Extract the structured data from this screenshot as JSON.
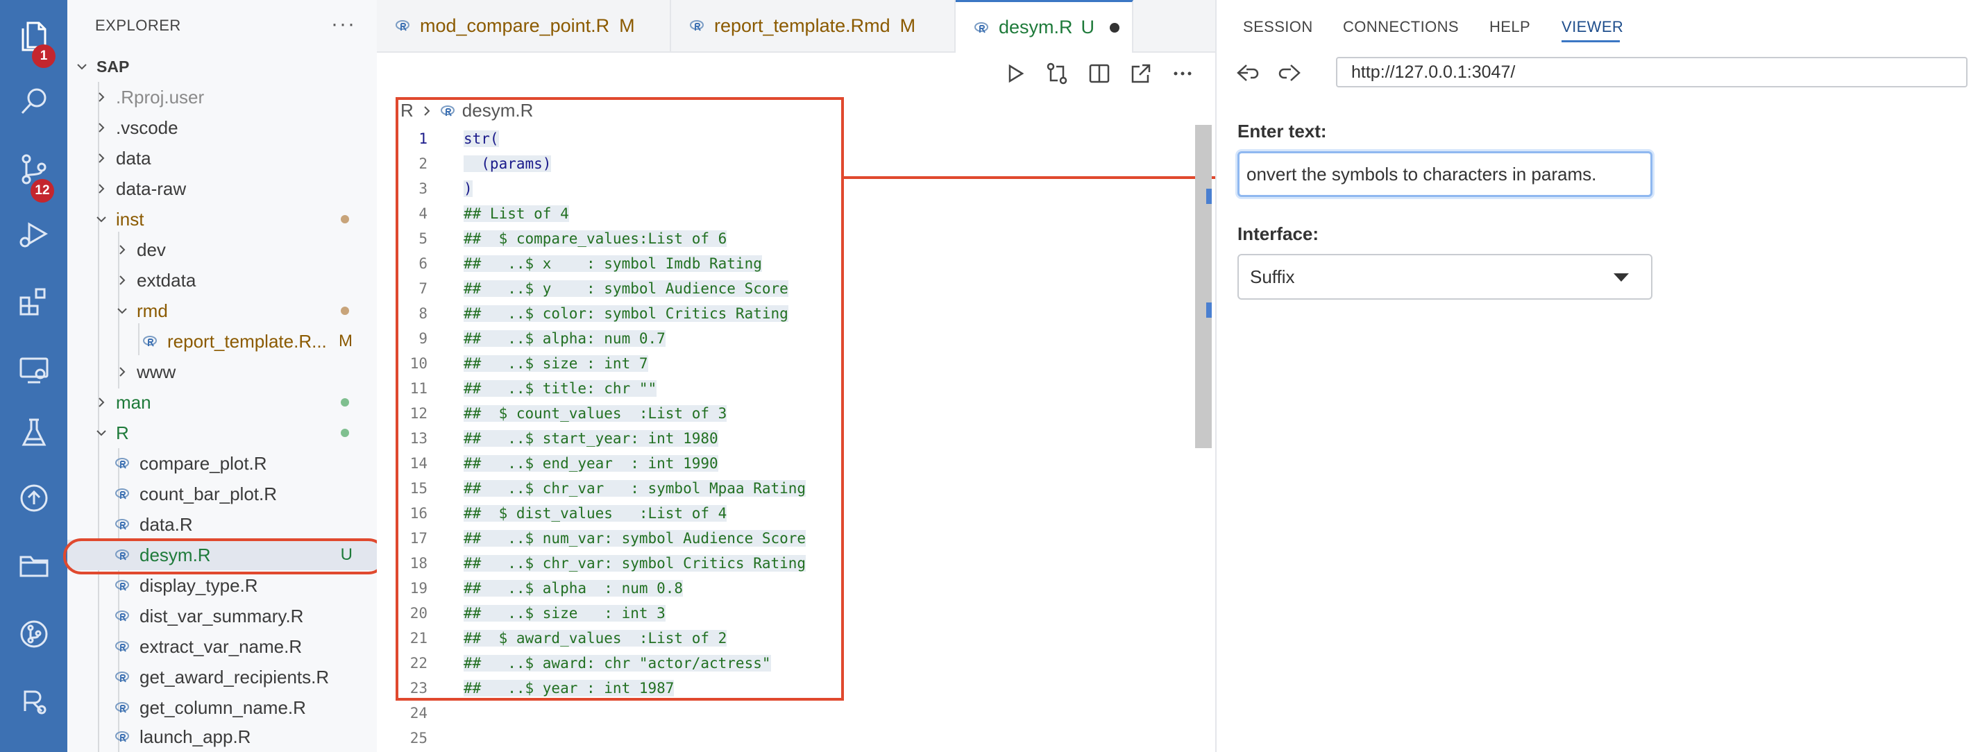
{
  "activity_bar": {
    "explorer_badge": "1",
    "scm_badge": "12"
  },
  "sidebar": {
    "header": "EXPLORER",
    "more": "···",
    "project": "SAP",
    "items": [
      {
        "label": ".Rproj.user"
      },
      {
        "label": ".vscode"
      },
      {
        "label": "data"
      },
      {
        "label": "data-raw"
      },
      {
        "label": "inst"
      },
      {
        "label": "dev"
      },
      {
        "label": "extdata"
      },
      {
        "label": "rmd"
      },
      {
        "label": "report_template.R...",
        "status": "M"
      },
      {
        "label": "www"
      },
      {
        "label": "man"
      },
      {
        "label": "R"
      },
      {
        "label": "compare_plot.R"
      },
      {
        "label": "count_bar_plot.R"
      },
      {
        "label": "data.R"
      },
      {
        "label": "desym.R",
        "status": "U"
      },
      {
        "label": "display_type.R"
      },
      {
        "label": "dist_var_summary.R"
      },
      {
        "label": "extract_var_name.R"
      },
      {
        "label": "get_award_recipients.R"
      },
      {
        "label": "get_column_name.R"
      },
      {
        "label": "launch_app.R"
      }
    ],
    "colors": {
      "modified": "#8b5a00",
      "untracked": "#1e7a3a",
      "ignored": "#8a8a8a"
    }
  },
  "tabs": [
    {
      "label": "mod_compare_point.R",
      "status": "M"
    },
    {
      "label": "report_template.Rmd",
      "status": "M"
    },
    {
      "label": "desym.R",
      "status": "U"
    }
  ],
  "editor": {
    "breadcrumb_root": "R",
    "breadcrumb_file": "desym.R",
    "lines": [
      "str(",
      "  (params)",
      ")",
      "## List of 4",
      "##  $ compare_values:List of 6",
      "##   ..$ x    : symbol Imdb Rating",
      "##   ..$ y    : symbol Audience Score",
      "##   ..$ color: symbol Critics Rating",
      "##   ..$ alpha: num 0.7",
      "##   ..$ size : int 7",
      "##   ..$ title: chr \"\"",
      "##  $ count_values  :List of 3",
      "##   ..$ start_year: int 1980",
      "##   ..$ end_year  : int 1990",
      "##   ..$ chr_var   : symbol Mpaa Rating",
      "##  $ dist_values   :List of 4",
      "##   ..$ num_var: symbol Audience Score",
      "##   ..$ chr_var: symbol Critics Rating",
      "##   ..$ alpha  : num 0.8",
      "##   ..$ size   : int 3",
      "##  $ award_values  :List of 2",
      "##   ..$ award: chr \"actor/actress\"",
      "##   ..$ year : int 1987",
      "",
      ""
    ],
    "line_numbers": [
      "1",
      "2",
      "3",
      "4",
      "5",
      "6",
      "7",
      "8",
      "9",
      "10",
      "11",
      "12",
      "13",
      "14",
      "15",
      "16",
      "17",
      "18",
      "19",
      "20",
      "21",
      "22",
      "23",
      "24",
      "25"
    ]
  },
  "panel": {
    "tabs": [
      "SESSION",
      "CONNECTIONS",
      "HELP",
      "VIEWER"
    ],
    "active_tab": "VIEWER",
    "url": "http://127.0.0.1:3047/",
    "enter_text_label": "Enter text:",
    "enter_text_value": "onvert the symbols to characters in params.",
    "interface_label": "Interface:",
    "interface_value": "Suffix"
  }
}
